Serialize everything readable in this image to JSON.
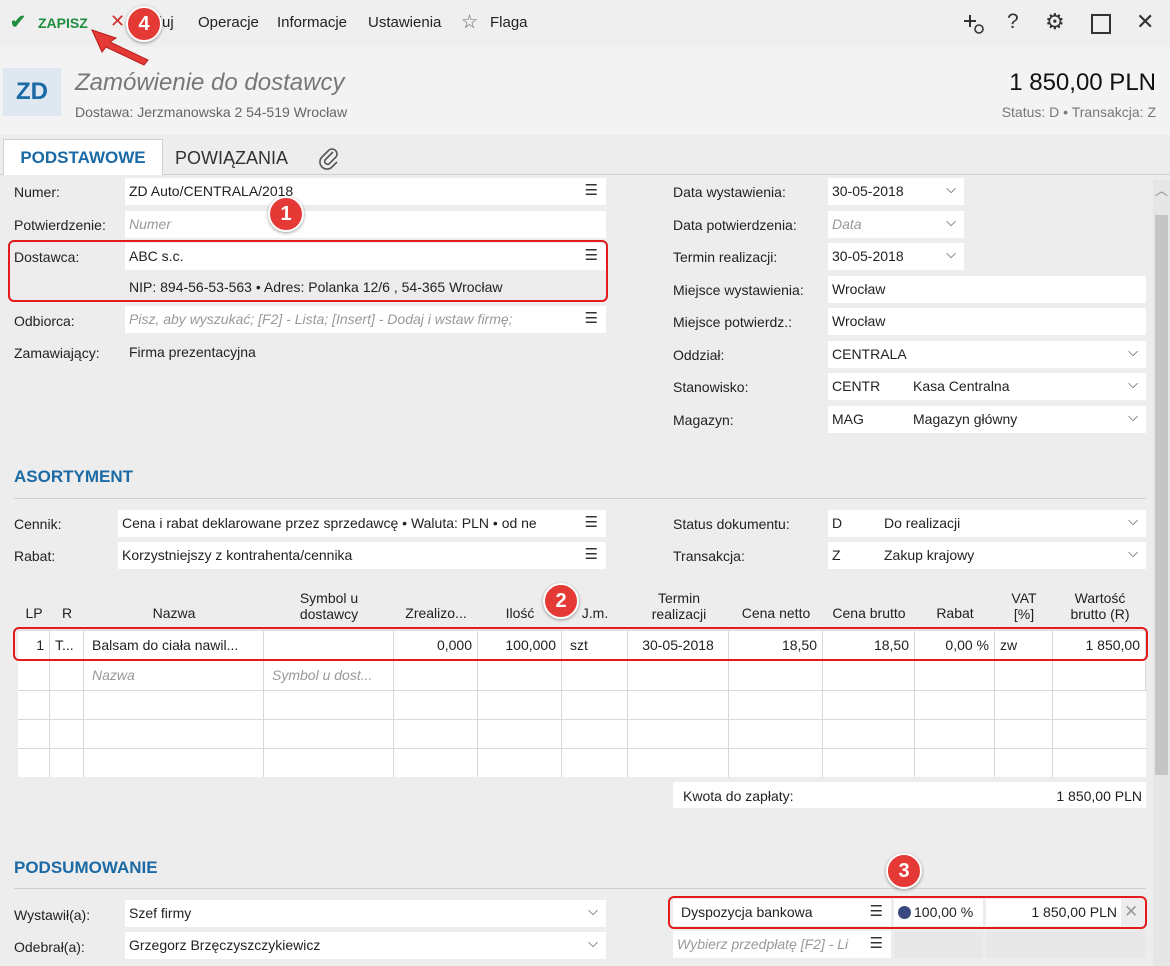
{
  "toolbar": {
    "save_label": "ZAPISZ",
    "cancel_label": "Anuluj",
    "operations_label": "Operacje",
    "info_label": "Informacje",
    "settings_label": "Ustawienia",
    "flag_label": "Flaga"
  },
  "header": {
    "badge": "ZD",
    "title": "Zamówienie do dostawcy",
    "delivery": "Dostawa: Jerzmanowska 2 54-519 Wrocław",
    "amount": "1 850,00 PLN",
    "status": "Status:  D  •  Transakcja:  Z"
  },
  "tabs": [
    "PODSTAWOWE",
    "POWIĄZANIA"
  ],
  "basic": {
    "numer_label": "Numer:",
    "numer_value": "ZD Auto/CENTRALA/2018",
    "potw_label": "Potwierdzenie:",
    "potw_placeholder": "Numer",
    "dostawca_label": "Dostawca:",
    "dostawca_value": "ABC s.c.",
    "dostawca_details": "NIP:  894-56-53-563  •  Adres:  Polanka  12/6 , 54-365 Wrocław",
    "odbiorca_label": "Odbiorca:",
    "odbiorca_placeholder": "Pisz, aby wyszukać; [F2] - Lista; [Insert] - Dodaj i wstaw firmę;",
    "zamawiajacy_label": "Zamawiający:",
    "zamawiajacy_value": "Firma prezentacyjna"
  },
  "right": {
    "data_wyst_label": "Data wystawienia:",
    "data_wyst_value": "30-05-2018",
    "data_potw_label": "Data potwierdzenia:",
    "data_potw_placeholder": "Data",
    "termin_label": "Termin realizacji:",
    "termin_value": "30-05-2018",
    "miejsce_wyst_label": "Miejsce wystawienia:",
    "miejsce_wyst_value": "Wrocław",
    "miejsce_potw_label": "Miejsce potwierdz.:",
    "miejsce_potw_value": "Wrocław",
    "oddzial_label": "Oddział:",
    "oddzial_value": "CENTRALA",
    "stanowisko_label": "Stanowisko:",
    "stanowisko_code": "CENTR",
    "stanowisko_name": "Kasa Centralna",
    "magazyn_label": "Magazyn:",
    "magazyn_code": "MAG",
    "magazyn_name": "Magazyn główny"
  },
  "asortyment": {
    "title": "ASORTYMENT",
    "cennik_label": "Cennik:",
    "cennik_value": "Cena i rabat deklarowane przez sprzedawcę • Waluta: PLN • od ne",
    "rabat_label": "Rabat:",
    "rabat_value": "Korzystniejszy z kontrahenta/cennika",
    "status_label": "Status dokumentu:",
    "status_code": "D",
    "status_name": "Do realizacji",
    "transakcja_label": "Transakcja:",
    "transakcja_code": "Z",
    "transakcja_name": "Zakup krajowy"
  },
  "grid": {
    "headers": [
      "LP",
      "R",
      "Nazwa",
      "Symbol u dostawcy",
      "Zrealizo...",
      "Ilość",
      "J.m.",
      "Termin realizacji",
      "Cena netto",
      "Cena brutto",
      "Rabat",
      "VAT [%]",
      "Wartość brutto (R)"
    ],
    "row": [
      "1",
      "T...",
      "Balsam do ciała nawil...",
      "",
      "0,000",
      "100,000",
      "szt",
      "30-05-2018",
      "18,50",
      "18,50",
      "0,00 %",
      "zw",
      "1 850,00"
    ],
    "name_placeholder": "Nazwa",
    "symbol_placeholder": "Symbol u dost...",
    "total_label": "Kwota do zapłaty:",
    "total_value": "1 850,00 PLN"
  },
  "summary": {
    "title": "PODSUMOWANIE",
    "wystawil_label": "Wystawił(a):",
    "wystawil_value": "Szef firmy",
    "odebral_label": "Odebrał(a):",
    "odebral_value": "Grzegorz Brzęczyszczykiewicz",
    "payment_name": "Dyspozycja bankowa",
    "payment_percent": "100,00 %",
    "payment_amount": "1 850,00 PLN",
    "prepay_placeholder": "Wybierz przedpłatę [F2] - Li"
  },
  "markers": [
    "1",
    "2",
    "3",
    "4"
  ],
  "colors": {
    "accent": "#1b6aa5",
    "save": "#1e8e3e",
    "marker": "#e53935"
  }
}
